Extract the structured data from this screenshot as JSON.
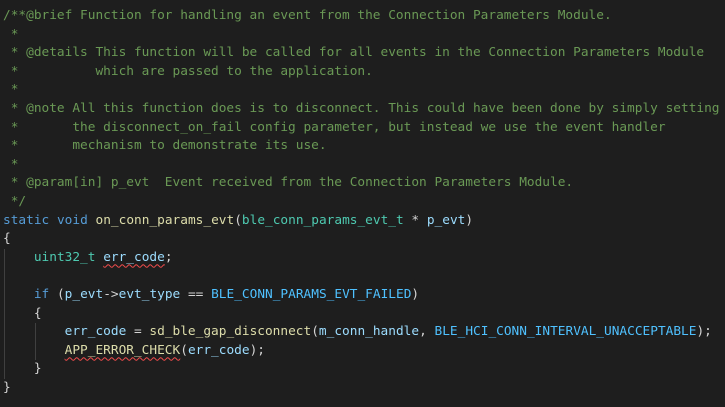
{
  "code_lines": [
    {
      "tokens": [
        {
          "t": "c",
          "v": "/**@brief Function for handling an event from the Connection Parameters Module."
        }
      ]
    },
    {
      "tokens": [
        {
          "t": "c",
          "v": " *"
        }
      ]
    },
    {
      "tokens": [
        {
          "t": "c",
          "v": " * @details This function will be called for all events in the Connection Parameters Module"
        }
      ]
    },
    {
      "tokens": [
        {
          "t": "c",
          "v": " *          which are passed to the application."
        }
      ]
    },
    {
      "tokens": [
        {
          "t": "c",
          "v": " *"
        }
      ]
    },
    {
      "tokens": [
        {
          "t": "c",
          "v": " * @note All this function does is to disconnect. This could have been done by simply setting"
        }
      ]
    },
    {
      "tokens": [
        {
          "t": "c",
          "v": " *       the disconnect_on_fail config parameter, but instead we use the event handler"
        }
      ]
    },
    {
      "tokens": [
        {
          "t": "c",
          "v": " *       mechanism to demonstrate its use."
        }
      ]
    },
    {
      "tokens": [
        {
          "t": "c",
          "v": " *"
        }
      ]
    },
    {
      "tokens": [
        {
          "t": "c",
          "v": " * @param[in] p_evt  Event received from the Connection Parameters Module."
        }
      ]
    },
    {
      "tokens": [
        {
          "t": "c",
          "v": " */"
        }
      ]
    },
    {
      "tokens": [
        {
          "t": "kw",
          "v": "static"
        },
        {
          "t": "pu",
          "v": " "
        },
        {
          "t": "kw",
          "v": "void"
        },
        {
          "t": "pu",
          "v": " "
        },
        {
          "t": "fn",
          "v": "on_conn_params_evt"
        },
        {
          "t": "pu",
          "v": "("
        },
        {
          "t": "ty",
          "v": "ble_conn_params_evt_t"
        },
        {
          "t": "pu",
          "v": " * "
        },
        {
          "t": "va",
          "v": "p_evt"
        },
        {
          "t": "pu",
          "v": ")"
        }
      ]
    },
    {
      "tokens": [
        {
          "t": "pu",
          "v": "{"
        }
      ]
    },
    {
      "guides": [
        1
      ],
      "tokens": [
        {
          "t": "pu",
          "v": "    "
        },
        {
          "t": "ty",
          "v": "uint32_t"
        },
        {
          "t": "pu",
          "v": " "
        },
        {
          "t": "va",
          "v": "err_code",
          "squig": true
        },
        {
          "t": "pu",
          "v": ";"
        }
      ]
    },
    {
      "guides": [
        1
      ],
      "tokens": [
        {
          "t": "pu",
          "v": ""
        }
      ]
    },
    {
      "guides": [
        1
      ],
      "tokens": [
        {
          "t": "pu",
          "v": "    "
        },
        {
          "t": "kw",
          "v": "if"
        },
        {
          "t": "pu",
          "v": " ("
        },
        {
          "t": "va",
          "v": "p_evt"
        },
        {
          "t": "pu",
          "v": "->"
        },
        {
          "t": "va",
          "v": "evt_type"
        },
        {
          "t": "pu",
          "v": " == "
        },
        {
          "t": "mc",
          "v": "BLE_CONN_PARAMS_EVT_FAILED"
        },
        {
          "t": "pu",
          "v": ")"
        }
      ]
    },
    {
      "guides": [
        1
      ],
      "tokens": [
        {
          "t": "pu",
          "v": "    {"
        }
      ]
    },
    {
      "guides": [
        1,
        2
      ],
      "tokens": [
        {
          "t": "pu",
          "v": "        "
        },
        {
          "t": "va",
          "v": "err_code"
        },
        {
          "t": "pu",
          "v": " = "
        },
        {
          "t": "fn",
          "v": "sd_ble_gap_disconnect"
        },
        {
          "t": "pu",
          "v": "("
        },
        {
          "t": "va",
          "v": "m_conn_handle"
        },
        {
          "t": "pu",
          "v": ", "
        },
        {
          "t": "mc",
          "v": "BLE_HCI_CONN_INTERVAL_UNACCEPTABLE"
        },
        {
          "t": "pu",
          "v": ");"
        }
      ]
    },
    {
      "guides": [
        1,
        2
      ],
      "tokens": [
        {
          "t": "pu",
          "v": "        "
        },
        {
          "t": "fn",
          "v": "APP_ERROR_CHECK",
          "squig": true
        },
        {
          "t": "pu",
          "v": "("
        },
        {
          "t": "va",
          "v": "err_code"
        },
        {
          "t": "pu",
          "v": ");"
        }
      ]
    },
    {
      "guides": [
        1
      ],
      "tokens": [
        {
          "t": "pu",
          "v": "    }"
        }
      ]
    },
    {
      "tokens": [
        {
          "t": "pu",
          "v": "}"
        }
      ]
    }
  ]
}
